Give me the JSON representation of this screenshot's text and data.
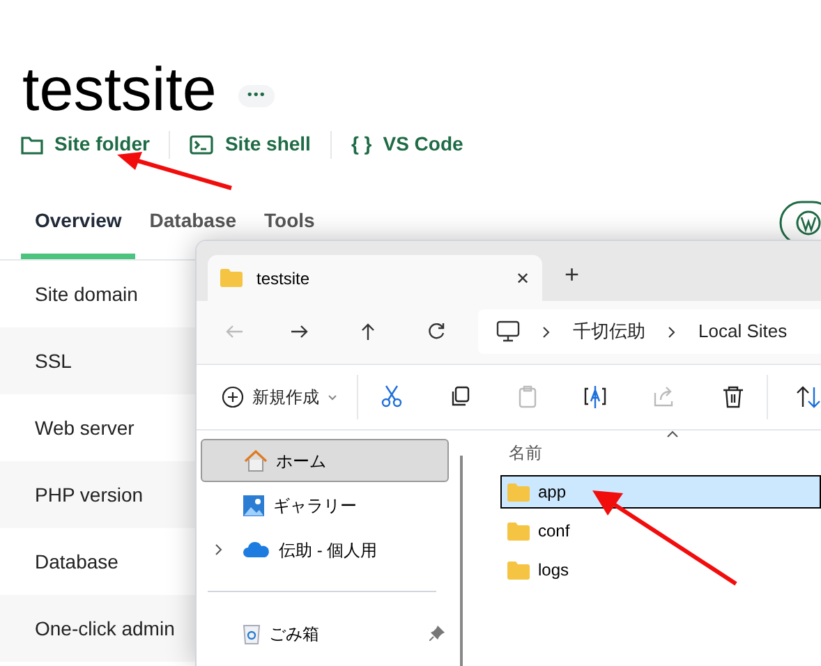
{
  "site": {
    "title": "testsite",
    "more_button": "•••",
    "actions": [
      {
        "kind": "folder",
        "label": "Site folder"
      },
      {
        "kind": "shell",
        "label": "Site shell"
      },
      {
        "kind": "code",
        "label": "VS Code",
        "glyph": "{ }"
      }
    ],
    "tabs": [
      {
        "label": "Overview",
        "selected": true
      },
      {
        "label": "Database",
        "selected": false
      },
      {
        "label": "Tools",
        "selected": false
      }
    ],
    "rows": [
      {
        "label": "Site domain"
      },
      {
        "label": "SSL"
      },
      {
        "label": "Web server"
      },
      {
        "label": "PHP version"
      },
      {
        "label": "Database"
      },
      {
        "label": "One-click admin"
      }
    ]
  },
  "explorer": {
    "tab": {
      "title": "testsite",
      "close": "✕",
      "new_tab": "+"
    },
    "breadcrumbs": [
      "千切伝助",
      "Local Sites"
    ],
    "toolbar": {
      "new_label": "新規作成"
    },
    "nav": [
      {
        "kind": "home",
        "label": "ホーム",
        "selected": true
      },
      {
        "kind": "gallery",
        "label": "ギャラリー",
        "selected": false
      },
      {
        "kind": "cloud",
        "label": "伝助 - 個人用",
        "selected": false,
        "expandable": true
      },
      {
        "kind": "divider"
      },
      {
        "kind": "trash",
        "label": "ごみ箱",
        "selected": false,
        "pinned": true
      }
    ],
    "column": "名前",
    "files": [
      {
        "name": "app",
        "selected": true
      },
      {
        "name": "conf",
        "selected": false
      },
      {
        "name": "logs",
        "selected": false
      }
    ]
  }
}
